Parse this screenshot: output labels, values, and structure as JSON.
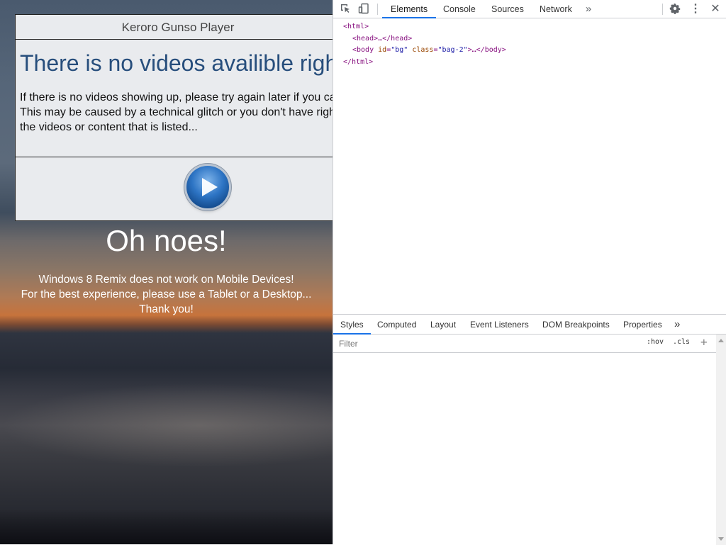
{
  "player": {
    "title": "Keroro Gunso Player",
    "heading": "There is no videos availible right n",
    "body_lines": [
      "If there is no videos showing up, please try again later if you ca",
      "This may be caused by a technical glitch or you don't have righ",
      "the videos or content that is listed..."
    ]
  },
  "mobile_notice": {
    "heading": "Oh noes!",
    "lines": [
      "Windows 8 Remix does not work on Mobile Devices!",
      "For the best experience, please use a Tablet or a Desktop...",
      "Thank you!"
    ]
  },
  "devtools": {
    "tabs": [
      "Elements",
      "Console",
      "Sources",
      "Network"
    ],
    "active_tab": "Elements",
    "more_tabs_icon": "chevron-double-right-icon",
    "dom": {
      "html_open": "<html>",
      "head": "<head>…</head>",
      "body_tag_open": "<body",
      "body_id_attr": "id",
      "body_id_val": "\"bg\"",
      "body_class_attr": "class",
      "body_class_val": "\"bag-2\"",
      "body_tail": ">…</body>",
      "html_close": "</html>"
    },
    "styles_tabs": [
      "Styles",
      "Computed",
      "Layout",
      "Event Listeners",
      "DOM Breakpoints",
      "Properties"
    ],
    "active_styles_tab": "Styles",
    "filter_placeholder": "Filter",
    "hov_label": ":hov",
    "cls_label": ".cls",
    "accent_color": "#1a73e8"
  }
}
